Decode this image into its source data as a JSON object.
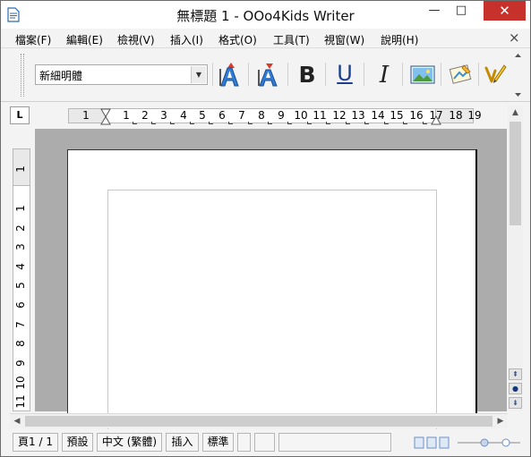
{
  "window": {
    "title": "無標題 1 - OOo4Kids Writer",
    "minimize_glyph": "—",
    "maximize_glyph": "□",
    "close_glyph": "✕"
  },
  "menu": {
    "items": [
      "檔案(F)",
      "編輯(E)",
      "檢視(V)",
      "插入(I)",
      "格式(O)",
      "工具(T)",
      "視窗(W)",
      "說明(H)"
    ],
    "close_glyph": "×"
  },
  "toolbar": {
    "font_name": "新細明體",
    "buttons": [
      {
        "name": "grow-font-icon"
      },
      {
        "name": "shrink-font-icon"
      },
      {
        "name": "bold-icon",
        "label": "B"
      },
      {
        "name": "underline-icon",
        "label": "U"
      },
      {
        "name": "italic-icon",
        "label": "I"
      },
      {
        "name": "insert-picture-icon"
      },
      {
        "name": "insert-drawing-icon"
      },
      {
        "name": "spell-check-icon"
      }
    ]
  },
  "ruler": {
    "tab_stop_glyph": "L",
    "horizontal_labels": [
      "1",
      "1",
      "2",
      "3",
      "4",
      "5",
      "6",
      "7",
      "8",
      "9",
      "10",
      "11",
      "12",
      "13",
      "14",
      "15",
      "16",
      "17",
      "18",
      "19"
    ],
    "vertical_labels": [
      "1",
      "1",
      "2",
      "3",
      "4",
      "5",
      "6",
      "7",
      "8",
      "9",
      "10",
      "11"
    ]
  },
  "statusbar": {
    "page": "頁1 / 1",
    "page_style": "預設",
    "language": "中文 (繁體)",
    "insert_mode": "插入",
    "selection_mode": "標準"
  },
  "colors": {
    "close_button": "#c7312b",
    "document_background": "#acacac",
    "chrome": "#f3f3f3"
  }
}
